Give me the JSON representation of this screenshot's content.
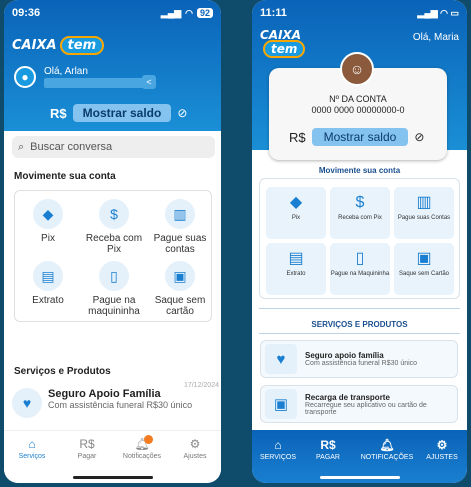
{
  "left": {
    "status": {
      "time": "09:36",
      "battery": "92"
    },
    "logo": {
      "brand": "CAIXA",
      "product": "tem"
    },
    "user": {
      "greeting": "Olá, Arlan"
    },
    "balance": {
      "currency": "R$",
      "show_label": "Mostrar saldo"
    },
    "search": {
      "placeholder": "Buscar conversa"
    },
    "actions_title": "Movimente sua conta",
    "actions": [
      {
        "label": "Pix",
        "icon": "pix-icon"
      },
      {
        "label": "Receba com Pix",
        "icon": "receive-money-icon"
      },
      {
        "label": "Pague suas contas",
        "icon": "barcode-icon"
      },
      {
        "label": "Extrato",
        "icon": "statement-icon"
      },
      {
        "label": "Pague na maquininha",
        "icon": "card-machine-icon"
      },
      {
        "label": "Saque sem cartão",
        "icon": "cash-icon"
      }
    ],
    "services_title": "Serviços e Produtos",
    "service": {
      "title": "Seguro Apoio Família",
      "subtitle": "Com assistência funeral R$30 único",
      "date": "17/12/2024"
    },
    "tabs": [
      {
        "label": "Serviços",
        "icon": "home-icon"
      },
      {
        "label": "Pagar",
        "icon": "rs-icon"
      },
      {
        "label": "Notificações",
        "icon": "bell-icon"
      },
      {
        "label": "Ajustes",
        "icon": "gear-icon"
      }
    ]
  },
  "right": {
    "status": {
      "time": "11:11"
    },
    "logo": {
      "brand": "CAIXA",
      "product": "tem"
    },
    "user": {
      "greeting": "Olá, Maria"
    },
    "account": {
      "label": "Nº DA CONTA",
      "number": "0000 0000 00000000-0"
    },
    "balance": {
      "currency": "R$",
      "show_label": "Mostrar saldo"
    },
    "actions_title": "Movimente sua conta",
    "actions": [
      {
        "label": "Pix",
        "icon": "pix-icon"
      },
      {
        "label": "Receba com Pix",
        "icon": "receive-money-icon"
      },
      {
        "label": "Pague suas Contas",
        "icon": "barcode-icon"
      },
      {
        "label": "Extrato",
        "icon": "statement-icon"
      },
      {
        "label": "Pague na Maquininha",
        "icon": "card-machine-icon"
      },
      {
        "label": "Saque sem Cartão",
        "icon": "cash-icon"
      }
    ],
    "services_title": "SERVIÇOS E PRODUTOS",
    "services": [
      {
        "title": "Seguro apoio família",
        "subtitle": "Com assistência funeral R$30 único",
        "icon": "heart-hands-icon"
      },
      {
        "title": "Recarga de transporte",
        "subtitle": "Recarregue seu aplicativo ou cartão de transporte",
        "icon": "bus-icon"
      }
    ],
    "tabs": [
      {
        "label": "SERVIÇOS",
        "icon": "home-icon"
      },
      {
        "label": "PAGAR",
        "icon": "rs-icon"
      },
      {
        "label": "NOTIFICAÇÕES",
        "icon": "bell-icon"
      },
      {
        "label": "AJUSTES",
        "icon": "gear-icon"
      }
    ]
  }
}
